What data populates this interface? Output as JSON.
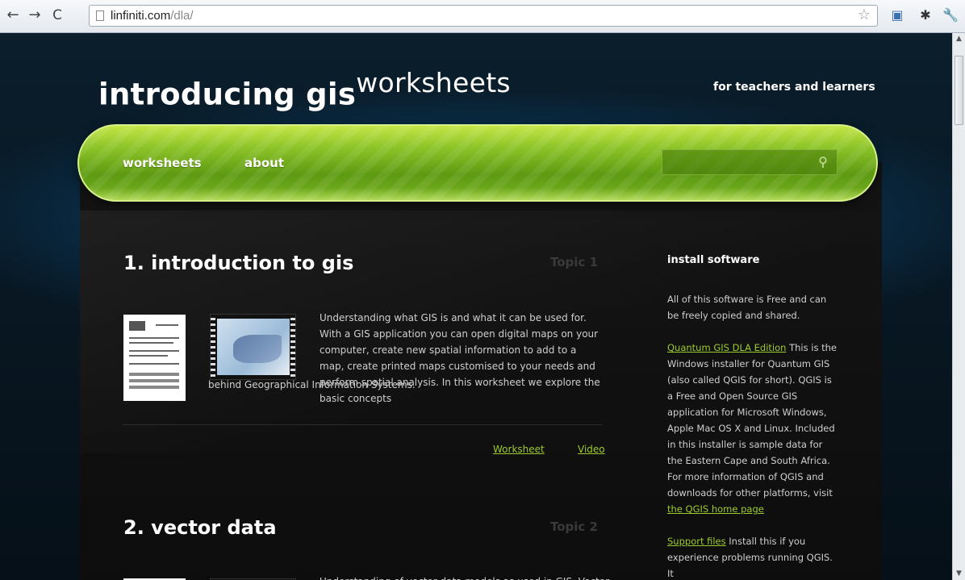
{
  "browser": {
    "url_host": "linfiniti.com",
    "url_path": "/dla/"
  },
  "header": {
    "title_main": "introducing gis",
    "title_sup": "worksheets",
    "tagline": "for teachers and learners"
  },
  "nav": {
    "items": [
      "worksheets",
      "about"
    ],
    "search_placeholder": ""
  },
  "topics": [
    {
      "title": "1. introduction to gis",
      "label": "Topic 1",
      "description_main": "Understanding what GIS is and what it can be used for. With a GIS application you can open digital maps on your computer, create new spatial information to add to a map, create printed maps customised to your needs and perform spatial analysis. In this worksheet we explore the basic concepts",
      "description_tail": "behind Geographical Information Systems.",
      "links": [
        "Worksheet",
        "Video"
      ]
    },
    {
      "title": "2. vector data",
      "label": "Topic 2",
      "description_main": "Understanding of vector data models as used in GIS. Vector"
    }
  ],
  "sidebar": {
    "heading": "install software",
    "intro": "All of this software is Free and can be freely copied and shared.",
    "qgis_link": "Quantum GIS DLA Edition",
    "qgis_text": " This is the Windows installer for Quantum GIS (also called QGIS for short). QGIS is a Free and Open Source GIS application for Microsoft Windows, Apple Mac OS X and Linux. Included in this installer is sample data for the Eastern Cape and South Africa. For more information of QGIS and downloads for other platforms, visit ",
    "qgis_home_link": "the QGIS home page",
    "support_link": "Support files",
    "support_text": " Install this if you experience problems running QGIS. It"
  },
  "colors": {
    "accent_green": "#9ecb2e",
    "nav_green": "#6aa61a",
    "background_blue": "#28a0e6"
  }
}
